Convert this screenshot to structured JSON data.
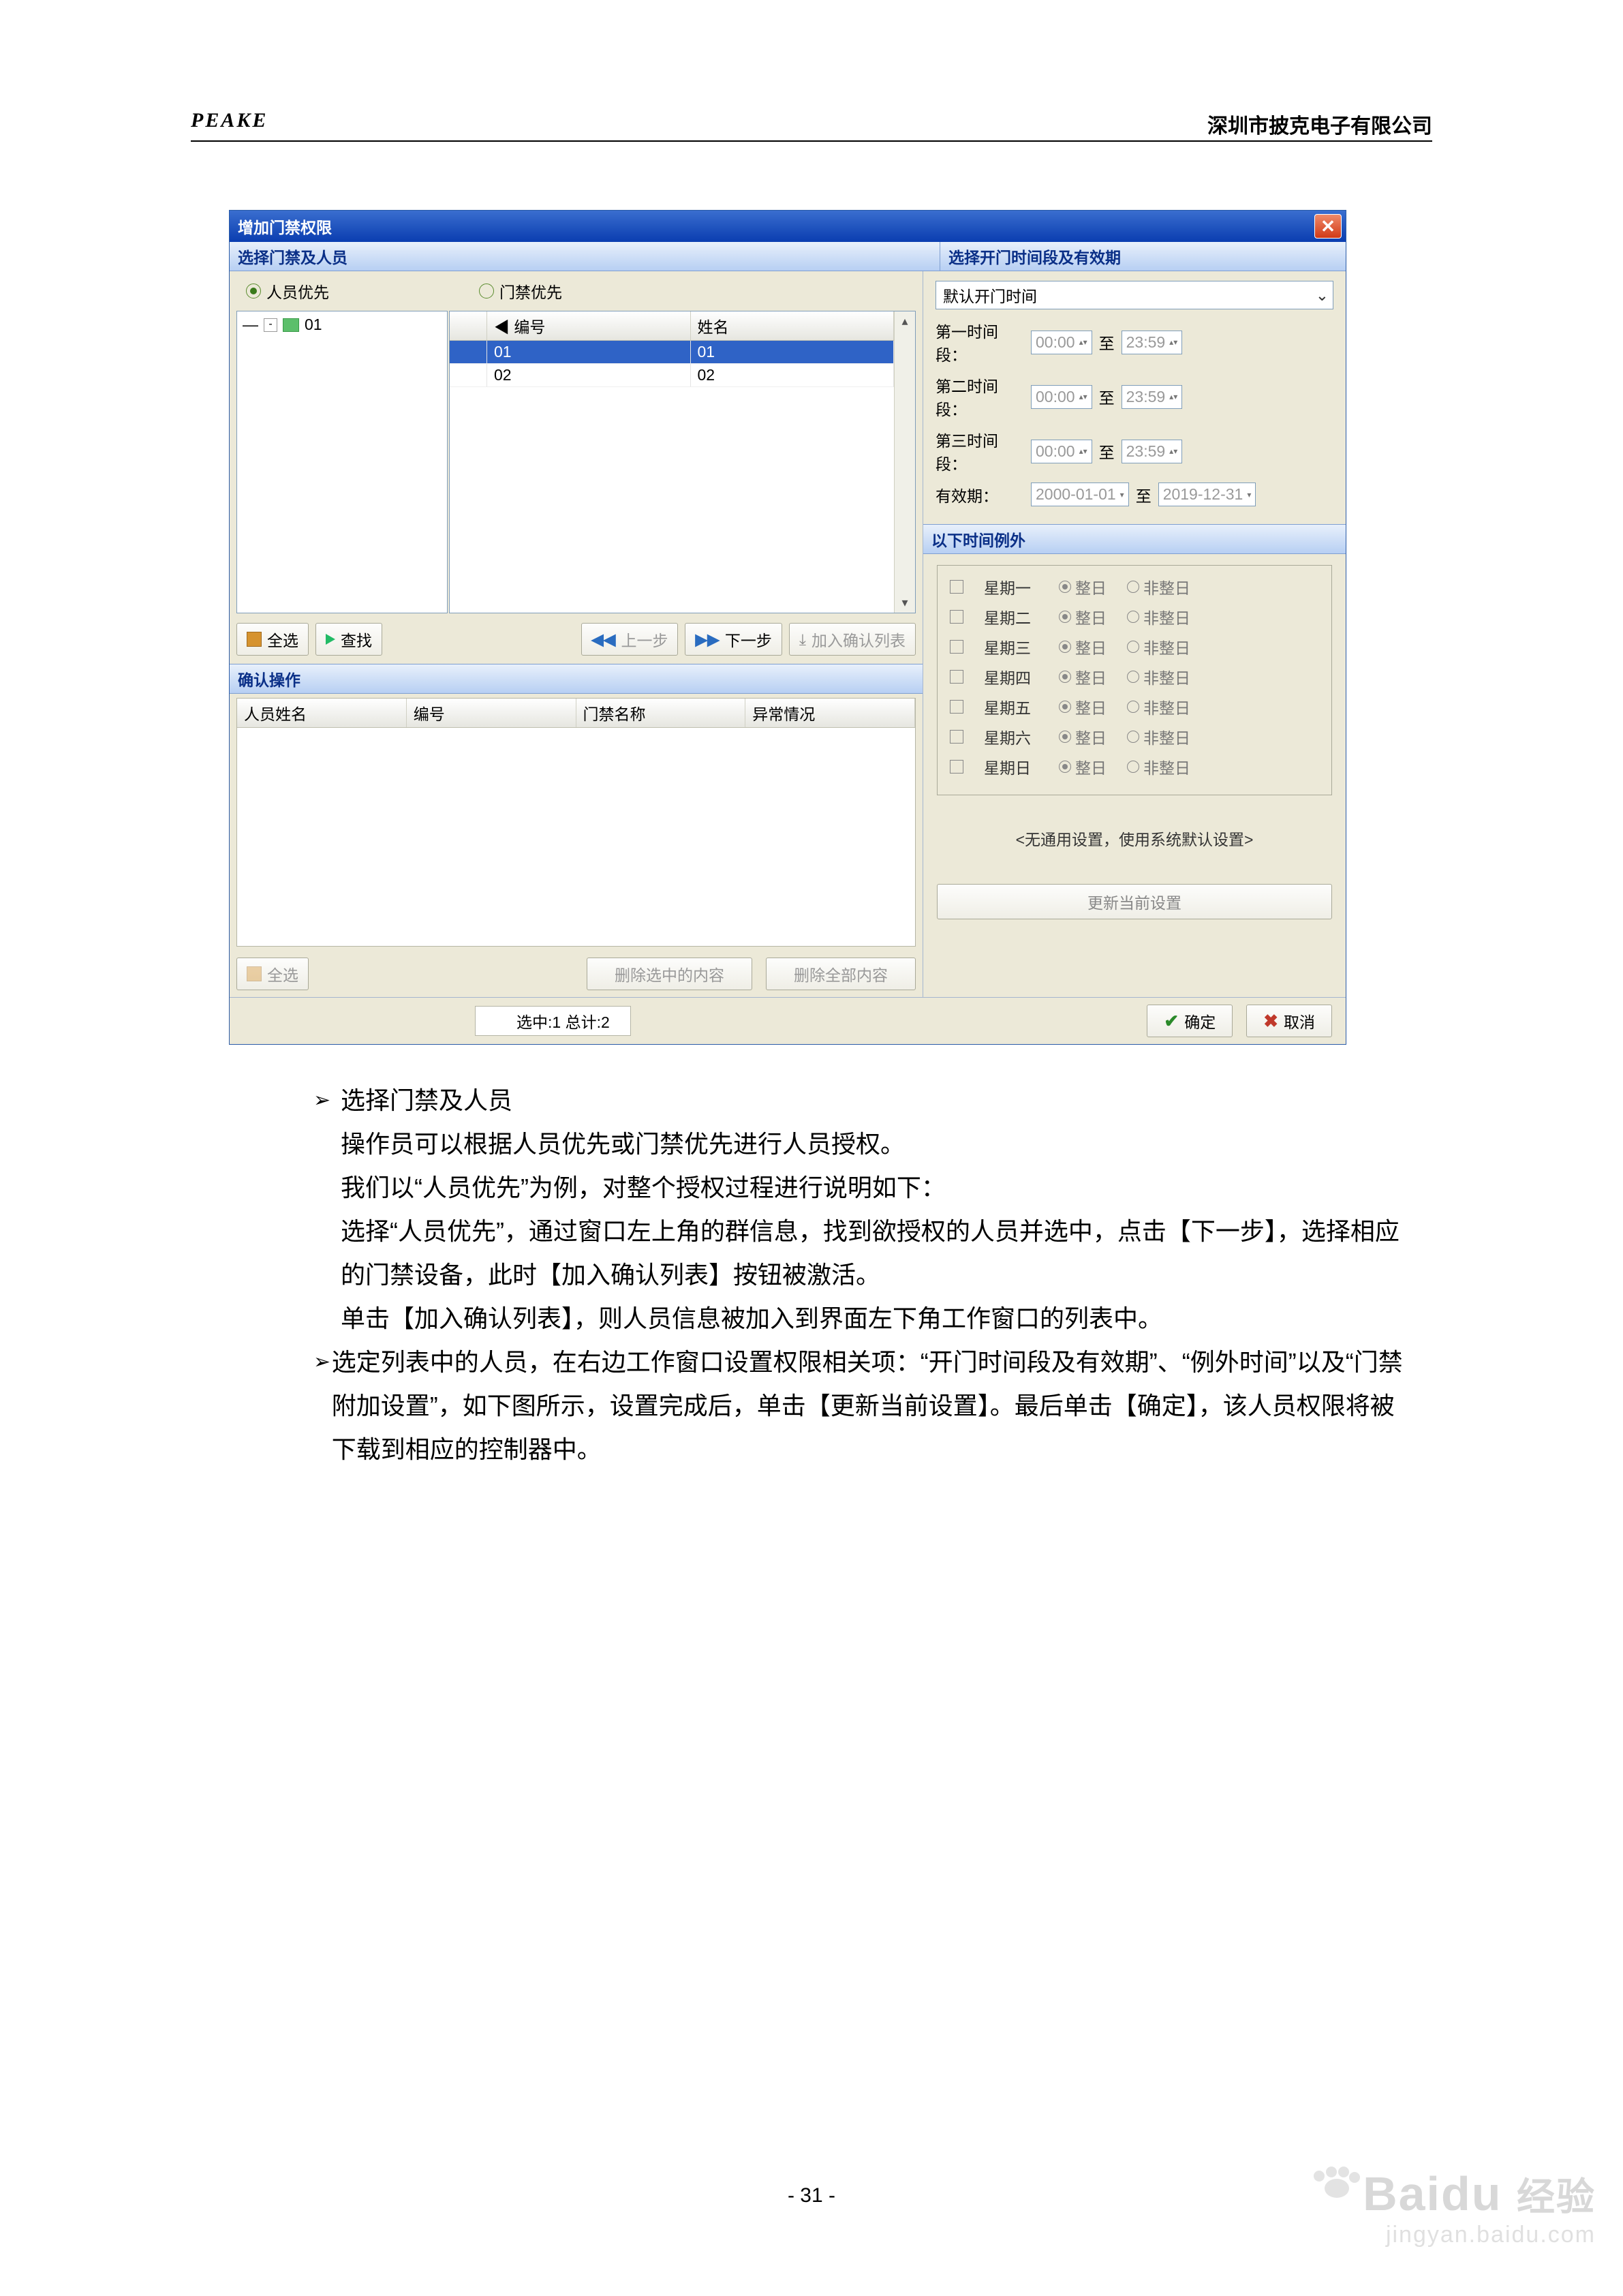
{
  "header": {
    "brand": "PEAKE",
    "company": "深圳市披克电子有限公司"
  },
  "win": {
    "title": "增加门禁权限",
    "left_header": "选择门禁及人员",
    "right_header": "选择开门时间段及有效期",
    "radios": {
      "person": "人员优先",
      "door": "门禁优先"
    },
    "tree_item": "01",
    "grid_headers": {
      "col1": "编号",
      "col2": "姓名"
    },
    "grid_rows": [
      {
        "c1": "01",
        "c2": "01",
        "selected": true
      },
      {
        "c1": "02",
        "c2": "02",
        "selected": false
      }
    ],
    "toolbar": {
      "select_all": "全选",
      "find": "查找",
      "prev": "上一步",
      "next": "下一步",
      "add": "加入确认列表"
    },
    "confirm_header": "确认操作",
    "confirm_cols": {
      "c1": "人员姓名",
      "c2": "编号",
      "c3": "门禁名称",
      "c4": "异常情况"
    },
    "confirm_toolbar": {
      "select_all": "全选",
      "del_sel": "删除选中的内容",
      "del_all": "删除全部内容"
    },
    "dropdown": "默认开门时间",
    "time_rows": [
      {
        "label": "第一时间段：",
        "from": "00:00",
        "to_label": "至",
        "to": "23:59"
      },
      {
        "label": "第二时间段：",
        "from": "00:00",
        "to_label": "至",
        "to": "23:59"
      },
      {
        "label": "第三时间段：",
        "from": "00:00",
        "to_label": "至",
        "to": "23:59"
      }
    ],
    "valid": {
      "label": "有效期：",
      "from": "2000-01-01",
      "to_label": "至",
      "to": "2019-12-31"
    },
    "except_header": "以下时间例外",
    "days": [
      "星期一",
      "星期二",
      "星期三",
      "星期四",
      "星期五",
      "星期六",
      "星期日"
    ],
    "opt_full": "整日",
    "opt_not": "非整日",
    "note": "<无通用设置，使用系统默认设置>",
    "update_btn": "更新当前设置",
    "status": "选中:1 总计:2",
    "ok": "确定",
    "cancel": "取消"
  },
  "doc": {
    "b1_title": "选择门禁及人员",
    "b1_l1": "操作员可以根据人员优先或门禁优先进行人员授权。",
    "b1_l2": "我们以“人员优先”为例，对整个授权过程进行说明如下：",
    "b1_l3": "选择“人员优先”，通过窗口左上角的群信息，找到欲授权的人员并选中，点击【下一步】，选择相应的门禁设备，此时【加入确认列表】按钮被激活。",
    "b1_l4": "单击【加入确认列表】，则人员信息被加入到界面左下角工作窗口的列表中。",
    "b2_l1": "选定列表中的人员，在右边工作窗口设置权限相关项：“开门时间段及有效期”、“例外时间”以及“门禁附加设置”，如下图所示，设置完成后，单击【更新当前设置】。最后单击【确定】，该人员权限将被下载到相应的控制器中。"
  },
  "page_number": "- 31 -",
  "watermark": {
    "brand": "Bai",
    "brand2": "du",
    "cn": "经验",
    "url": "jingyan.baidu.com"
  }
}
